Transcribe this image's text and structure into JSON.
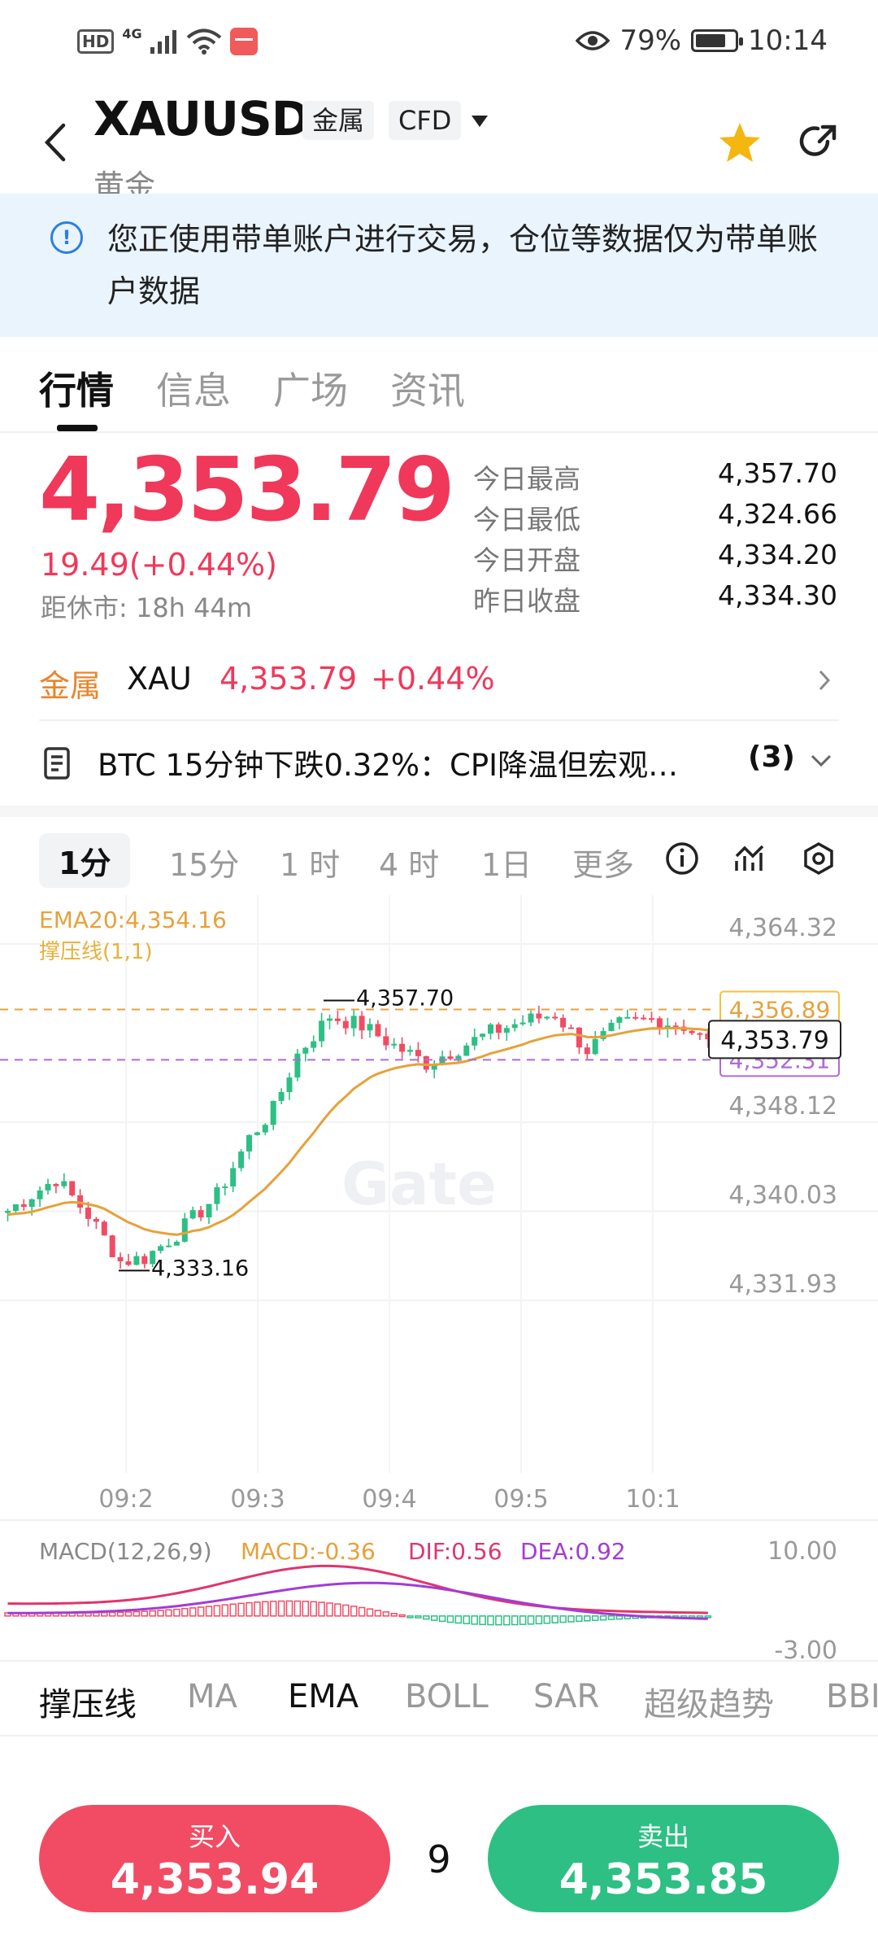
{
  "status_bar": {
    "hd": "HD",
    "net": "4G",
    "battery_pct": "79%",
    "battery_level": 0.79,
    "time": "10:14"
  },
  "header": {
    "symbol": "XAUUSD",
    "tag1": "金属",
    "tag2": "CFD",
    "subname": "黄金"
  },
  "banner": {
    "text": "您正使用带单账户进行交易，仓位等数据仅为带单账户数据"
  },
  "tabs": [
    {
      "label": "行情",
      "active": true
    },
    {
      "label": "信息",
      "active": false
    },
    {
      "label": "广场",
      "active": false
    },
    {
      "label": "资讯",
      "active": false
    }
  ],
  "quote": {
    "price": "4,353.79",
    "change": "19.49(+0.44%)",
    "close_in": "距休市: 18h 44m",
    "stats": [
      {
        "label": "今日最高",
        "value": "4,357.70"
      },
      {
        "label": "今日最低",
        "value": "4,324.66"
      },
      {
        "label": "今日开盘",
        "value": "4,334.20"
      },
      {
        "label": "昨日收盘",
        "value": "4,334.30"
      }
    ]
  },
  "related": {
    "category": "金属",
    "symbol": "XAU",
    "price": "4,353.79",
    "change": "+0.44%"
  },
  "news": {
    "headline": "BTC 15分钟下跌0.32%：CPI降温但宏观…",
    "count": "(3)"
  },
  "intervals": [
    "1分",
    "15分",
    "1 时",
    "4 时",
    "1日",
    "更多"
  ],
  "chart": {
    "ema_label": "EMA20:4,354.16",
    "sr_label": "撑压线(1,1)",
    "y_ticks": [
      "4,364.32",
      "4,348.12",
      "4,340.03",
      "4,331.93"
    ],
    "x_ticks": [
      "09:2",
      "09:3",
      "09:4",
      "09:5",
      "10:1"
    ],
    "high_label": "4,357.70",
    "low_label": "4,333.16",
    "resistance": "4,356.89",
    "current": "4,353.79",
    "support": "4,352.31",
    "watermark": "Gate",
    "macd_label": "MACD(12,26,9)",
    "macd_value": "MACD:-0.36",
    "dif_value": "DIF:0.56",
    "dea_value": "DEA:0.92",
    "macd_top": "10.00",
    "macd_bottom": "-3.00"
  },
  "indicator_tabs": [
    "撑压线",
    "MA",
    "EMA",
    "BOLL",
    "SAR",
    "超级趋势",
    "BBI"
  ],
  "trade": {
    "buy_label": "买入",
    "buy_price": "4,353.94",
    "lot": "9",
    "sell_label": "卖出",
    "sell_price": "4,353.85"
  },
  "colors": {
    "up": "#2dbf84",
    "down": "#f14c63",
    "ema": "#e7a13a",
    "accent": "#f0385a"
  },
  "chart_data": {
    "type": "candlestick",
    "ylim": [
      4331.93,
      4364.32
    ],
    "y_ticks": [
      4364.32,
      4348.12,
      4340.03,
      4331.93
    ],
    "x_ticks": [
      "09:2",
      "09:3",
      "09:4",
      "09:5",
      "10:1"
    ],
    "resistance": 4356.89,
    "support": 4352.31,
    "last": 4353.79,
    "ema_last": 4354.16,
    "high": 4357.7,
    "low": 4333.16
  }
}
